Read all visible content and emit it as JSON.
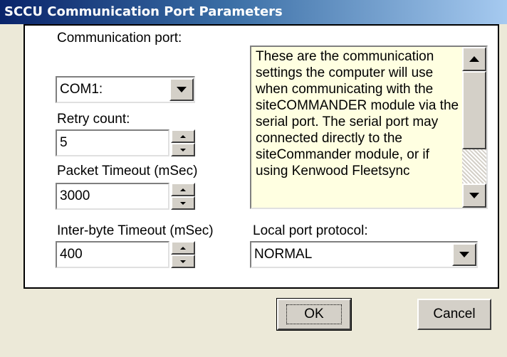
{
  "window": {
    "title": "SCCU Communication Port Parameters"
  },
  "fields": {
    "comm_port": {
      "label": "Communication port:",
      "value": "COM1:"
    },
    "retry_count": {
      "label": "Retry count:",
      "value": "5"
    },
    "packet_timeout": {
      "label": "Packet Timeout (mSec)",
      "value": "3000"
    },
    "interbyte_timeout": {
      "label": "Inter-byte Timeout (mSec)",
      "value": "400"
    },
    "protocol": {
      "label": "Local port protocol:",
      "value": "NORMAL"
    }
  },
  "info": {
    "text": "These are the communication settings the computer will use when communicating with the siteCOMMANDER module via the serial port. The serial port may connected directly to the siteCommander module, or if using Kenwood Fleetsync"
  },
  "buttons": {
    "ok": "OK",
    "cancel": "Cancel"
  },
  "icons": {
    "dropdown": "chevron-down-icon",
    "spin_up": "spin-up-icon",
    "spin_down": "spin-down-icon",
    "scroll_up": "scroll-up-icon",
    "scroll_down": "scroll-down-icon"
  },
  "colors": {
    "title_start": "#0a246a",
    "title_end": "#a6caf0",
    "info_background": "#ffffe1",
    "dialog_background": "#ece9d8"
  }
}
